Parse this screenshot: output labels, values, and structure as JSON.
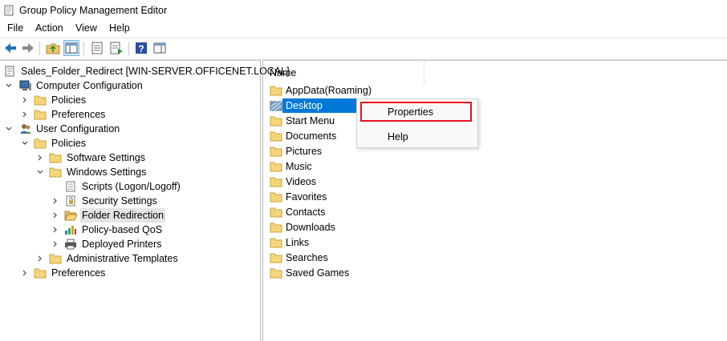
{
  "window": {
    "title": "Group Policy Management Editor"
  },
  "menu": {
    "items": [
      "File",
      "Action",
      "View",
      "Help"
    ]
  },
  "toolbar": {
    "icons": [
      "back-icon",
      "forward-icon",
      "up-folder-icon",
      "show-hide-tree-icon",
      "export-list-icon",
      "properties-icon",
      "help-icon",
      "show-pane-icon"
    ]
  },
  "tree": {
    "root": "Sales_Folder_Redirect [WIN-SERVER.OFFICENET.LOCAL]",
    "computer_config": "Computer Configuration",
    "cc_policies": "Policies",
    "cc_preferences": "Preferences",
    "user_config": "User Configuration",
    "uc_policies": "Policies",
    "software_settings": "Software Settings",
    "windows_settings": "Windows Settings",
    "scripts": "Scripts (Logon/Logoff)",
    "security_settings": "Security Settings",
    "folder_redirection": "Folder Redirection",
    "policy_qos": "Policy-based QoS",
    "deployed_printers": "Deployed Printers",
    "admin_templates": "Administrative Templates",
    "uc_preferences": "Preferences"
  },
  "list": {
    "column": "Name",
    "items": [
      "AppData(Roaming)",
      "Desktop",
      "Start Menu",
      "Documents",
      "Pictures",
      "Music",
      "Videos",
      "Favorites",
      "Contacts",
      "Downloads",
      "Links",
      "Searches",
      "Saved Games"
    ],
    "selected": "Desktop"
  },
  "context_menu": {
    "items": [
      "Properties",
      "Help"
    ],
    "highlighted": "Properties"
  }
}
